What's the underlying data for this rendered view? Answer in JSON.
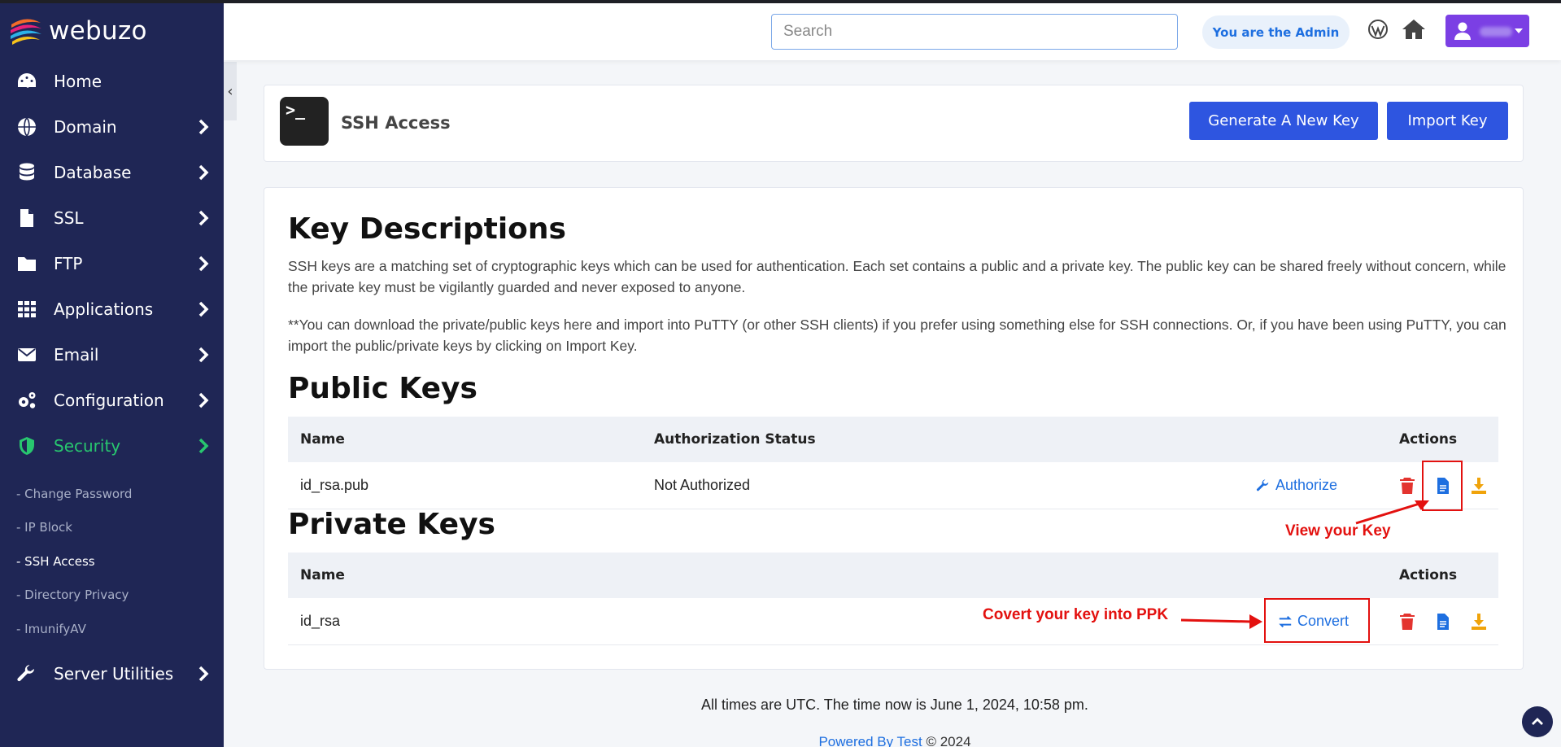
{
  "app": {
    "brand": "webuzo"
  },
  "topbar": {
    "search_placeholder": "Search",
    "admin_badge": "You are the Admin",
    "wordpress_icon": "wordpress-icon",
    "home_icon": "home-icon",
    "user_icon": "user-icon"
  },
  "sidebar": {
    "items": [
      {
        "label": "Home",
        "icon": "dashboard-icon"
      },
      {
        "label": "Domain",
        "icon": "globe-icon"
      },
      {
        "label": "Database",
        "icon": "database-icon"
      },
      {
        "label": "SSL",
        "icon": "file-icon"
      },
      {
        "label": "FTP",
        "icon": "folder-icon"
      },
      {
        "label": "Applications",
        "icon": "grid-icon"
      },
      {
        "label": "Email",
        "icon": "envelope-icon"
      },
      {
        "label": "Configuration",
        "icon": "gears-icon"
      },
      {
        "label": "Security",
        "icon": "shield-icon"
      },
      {
        "label": "Server Utilities",
        "icon": "wrench-icon"
      }
    ],
    "security_submenu": [
      "- Change Password",
      "- IP Block",
      "- SSH Access",
      "- Directory Privacy",
      "- ImunifyAV"
    ],
    "active_color": "#28c76f"
  },
  "header": {
    "title": "SSH Access",
    "generate_button": "Generate A New Key",
    "import_button": "Import Key"
  },
  "content": {
    "heading": "Key Descriptions",
    "paragraph1": "SSH keys are a matching set of cryptographic keys which can be used for authentication. Each set contains a public and a private key. The public key can be shared freely without concern, while the private key must be vigilantly guarded and never exposed to anyone.",
    "paragraph2": "**You can download the private/public keys here and import into PuTTY (or other SSH clients) if you prefer using something else for SSH connections. Or, if you have been using PuTTY, you can import the public/private keys by clicking on Import Key.",
    "public_heading": "Public Keys",
    "public_columns": [
      "Name",
      "Authorization Status",
      "Actions"
    ],
    "public_rows": [
      {
        "name": "id_rsa.pub",
        "status": "Not Authorized",
        "action_link": "Authorize"
      }
    ],
    "private_heading": "Private Keys",
    "private_columns": [
      "Name",
      "Actions"
    ],
    "private_rows": [
      {
        "name": "id_rsa",
        "action_link": "Convert"
      }
    ]
  },
  "annotations": {
    "view_key": "View your Key",
    "convert_key": "Covert your key into PPK"
  },
  "footer": {
    "time_text": "All times are UTC. The time now is June 1, 2024, 10:58 pm.",
    "powered_link": "Powered By Test",
    "copyright": "© 2024"
  },
  "colors": {
    "sidebar_bg": "#1f2655",
    "primary": "#2e55e0",
    "link": "#1e6fe0",
    "danger": "#e3342f",
    "download": "#f0a30a",
    "annotation": "#e3110f"
  }
}
